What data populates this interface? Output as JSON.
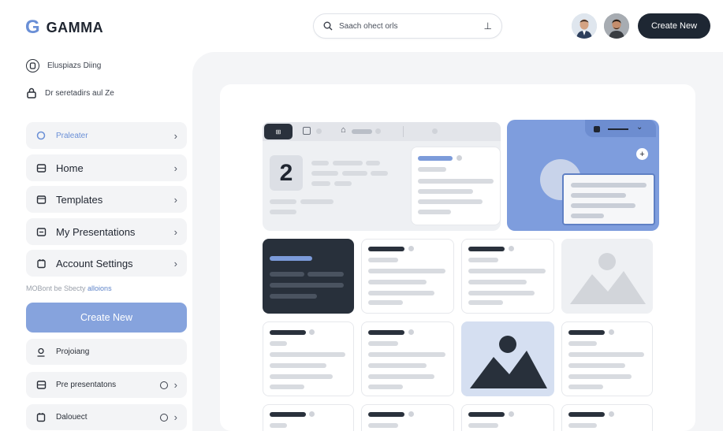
{
  "header": {
    "logo_mark": "G",
    "logo_text": "GAMMA",
    "search_placeholder": "Saach ohect orls",
    "search_action_glyph": "⊥",
    "create_button": "Create New",
    "avatars": [
      "user-avatar-1",
      "user-avatar-2"
    ]
  },
  "sidebar": {
    "top_links": [
      {
        "label": "Eluspiazs Diing",
        "icon": "circle-person-icon"
      },
      {
        "label": "Dr seretadirs aul Ze",
        "icon": "lock-icon"
      }
    ],
    "nav_items": [
      {
        "label": "Praleater",
        "icon": "circle-icon",
        "active": true
      },
      {
        "label": "Home",
        "icon": "home-icon"
      },
      {
        "label": "Templates",
        "icon": "templates-icon"
      },
      {
        "label": "My Presentations",
        "icon": "presentations-icon"
      },
      {
        "label": "Account Settings",
        "icon": "settings-icon"
      }
    ],
    "hint_text": "MOBont be Sbecty ",
    "hint_link": "alloions",
    "create_button": "Create New",
    "bottom_items": [
      {
        "label": "Projoiang",
        "icon": "person-icon"
      },
      {
        "label": "Pre presentatons",
        "icon": "presentation-icon"
      },
      {
        "label": "Dalouect",
        "icon": "document-icon"
      }
    ]
  },
  "canvas": {
    "hero_number": "2",
    "toolbar_button": "⊞",
    "panel_plus": "+"
  },
  "colors": {
    "accent": "#86a3dd",
    "accent_text": "#6a8fd6",
    "dark": "#1e2733",
    "surface": "#f4f5f7"
  }
}
